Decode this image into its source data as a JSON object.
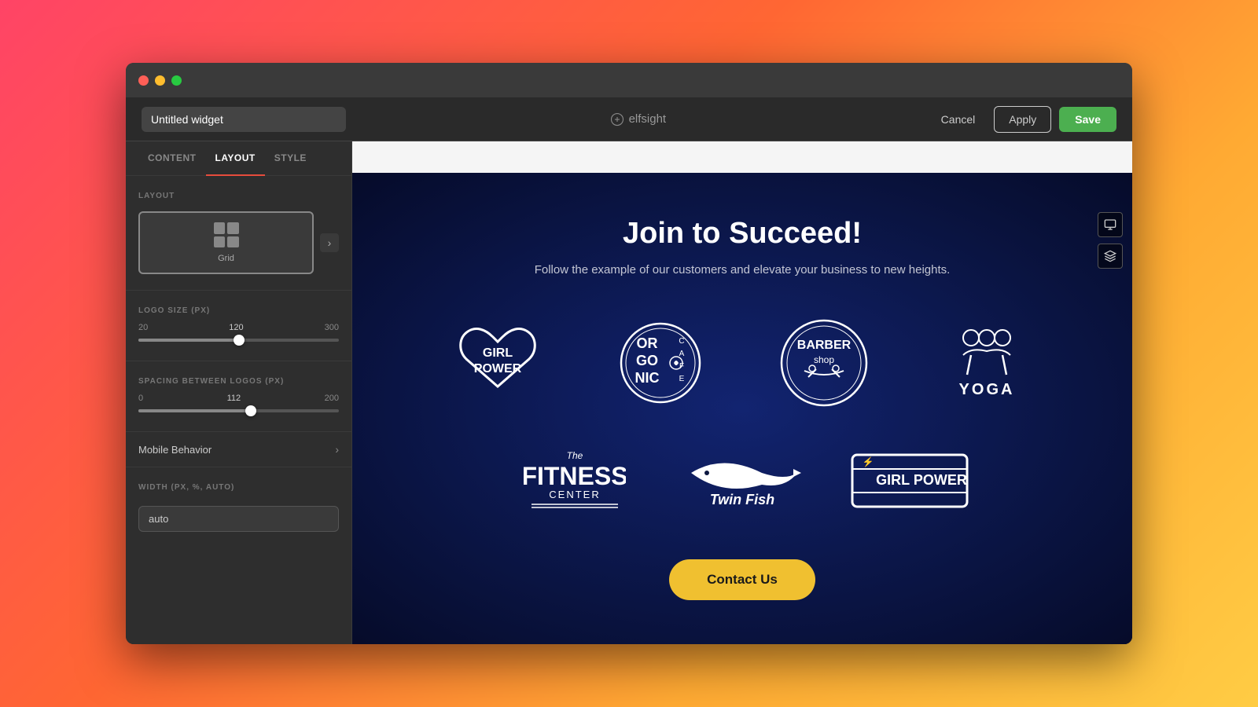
{
  "window": {
    "title": "Untitled widget"
  },
  "header": {
    "widget_title": "Untitled widget",
    "brand_name": "elfsight",
    "cancel_label": "Cancel",
    "apply_label": "Apply",
    "save_label": "Save"
  },
  "tabs": [
    {
      "id": "content",
      "label": "CONTENT",
      "active": false
    },
    {
      "id": "layout",
      "label": "LAYOUT",
      "active": true
    },
    {
      "id": "style",
      "label": "STYLE",
      "active": false
    }
  ],
  "sidebar": {
    "layout_label": "LAYOUT",
    "layout_option": "Grid",
    "logo_size_label": "LOGO SIZE (PX)",
    "logo_size_min": "20",
    "logo_size_val": "120",
    "logo_size_max": "300",
    "logo_size_pct": 50,
    "spacing_label": "SPACING BETWEEN LOGOS (PX)",
    "spacing_min": "0",
    "spacing_val": "112",
    "spacing_max": "200",
    "spacing_pct": 56,
    "mobile_behavior_label": "Mobile Behavior",
    "width_label": "WIDTH (PX, %, AUTO)",
    "width_value": "auto"
  },
  "preview": {
    "title": "Join to Succeed!",
    "subtitle": "Follow the example of our customers and elevate your business to new heights.",
    "contact_btn_label": "Contact Us",
    "logos": [
      {
        "name": "Girl Power",
        "type": "heart"
      },
      {
        "name": "Organic Cafe",
        "type": "circle-text"
      },
      {
        "name": "Barber Shop",
        "type": "barber"
      },
      {
        "name": "Yoga",
        "type": "yoga"
      },
      {
        "name": "The Fitness Center",
        "type": "fitness"
      },
      {
        "name": "Twin Fish",
        "type": "fish"
      },
      {
        "name": "Girl Power 2",
        "type": "badge"
      }
    ]
  }
}
